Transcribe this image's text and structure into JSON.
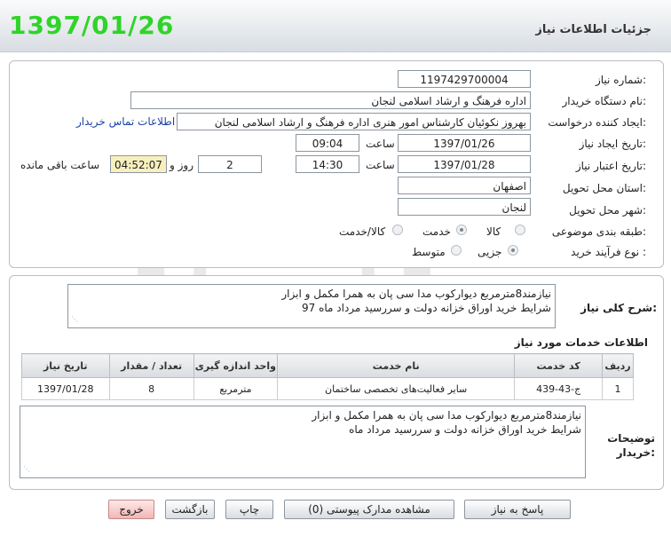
{
  "header": {
    "title": "جزئیات اطلاعات نیاز",
    "date": "1397/01/26"
  },
  "form": {
    "need_number": {
      "label": "شماره نیاز:",
      "value": "1197429700004"
    },
    "buyer_org": {
      "label": "نام دستگاه خریدار:",
      "value": "اداره فرهنگ و ارشاد اسلامی لنجان"
    },
    "requester": {
      "label": "ایجاد کننده درخواست:",
      "value": "بهروز  نکوئیان  کارشناس امور هنری اداره فرهنگ و ارشاد اسلامی لنجان",
      "contact_link": "اطلاعات تماس خریدار"
    },
    "created": {
      "label": "تاریخ ایجاد نیاز:",
      "date": "1397/01/26",
      "time_label": "ساعت",
      "time": "09:04"
    },
    "validity": {
      "label": "تاریخ اعتبار نیاز:",
      "date": "1397/01/28",
      "time_label": "ساعت",
      "time": "14:30",
      "days": "2",
      "days_label": "روز و",
      "remaining": "04:52:07",
      "remaining_label": "ساعت باقی مانده"
    },
    "province": {
      "label": "استان محل تحویل:",
      "value": "اصفهان"
    },
    "city": {
      "label": "شهر محل تحویل:",
      "value": "لنجان"
    },
    "category": {
      "label": "طبقه بندی موضوعی:",
      "options": [
        "کالا",
        "خدمت",
        "کالا/خدمت"
      ],
      "selected": "خدمت"
    },
    "process": {
      "label": "نوع فرآیند خرید :",
      "options": [
        "جزیی",
        "متوسط"
      ],
      "selected": "جزیی"
    }
  },
  "description": {
    "label": "شرح کلی نیاز:",
    "line1": "نیازمند8مترمربع دیوارکوب مدا سی پان به همرا مکمل و ابزار",
    "line2": "شرایط خرید اوراق خزانه دولت و سررسید مرداد ماه 97"
  },
  "services": {
    "title": "اطلاعات خدمات مورد نیاز",
    "columns": [
      "ردیف",
      "کد خدمت",
      "نام خدمت",
      "واحد اندازه گیری",
      "تعداد / مقدار",
      "تاریخ نیاز"
    ],
    "rows": [
      [
        "1",
        "ج-43-439",
        "سایر فعالیت‌های تخصصی ساختمان",
        "مترمربع",
        "8",
        "1397/01/28"
      ]
    ]
  },
  "buyer_notes": {
    "label": "توضیحات خریدار:",
    "line1": "نیازمند8مترمربع دیوارکوب مدا سی پان به همرا مکمل و ابزار",
    "line2": "شرایط خرید اوراق خزانه دولت و سررسید مرداد ماه"
  },
  "buttons": {
    "reply": "پاسخ به نیاز",
    "attachments": "مشاهده مدارک پیوستی (0)",
    "print": "چاپ",
    "back": "بازگشت",
    "exit": "خروج"
  },
  "colors": {
    "date_green": "#2fd42a",
    "link_blue": "#1a43a8",
    "remaining_bg": "#f7efbd"
  }
}
